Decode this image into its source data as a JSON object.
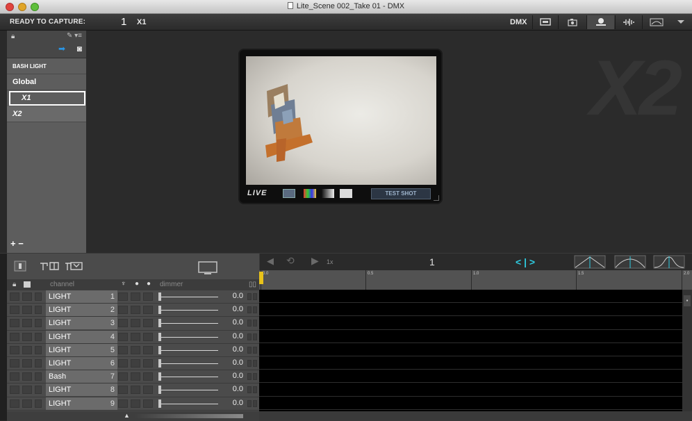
{
  "window": {
    "title": "Lite_Scene 002_Take 01 - DMX"
  },
  "topbar": {
    "status": "READY TO CAPTURE:",
    "frame": "1",
    "scene": "X1",
    "mode": "DMX"
  },
  "sidebar": {
    "header": "BASH LIGHT",
    "items": [
      {
        "label": "Global"
      },
      {
        "label": "X1"
      },
      {
        "label": "X2"
      }
    ],
    "add_remove": "+ −"
  },
  "viewer": {
    "scene_watermark": "X2",
    "live_label": "LIVE",
    "test_shot_label": "TEST SHOT"
  },
  "channels": {
    "header": {
      "channel": "channel",
      "dimmer": "dimmer"
    },
    "rows": [
      {
        "name": "LIGHT",
        "num": "1",
        "value": "0.0"
      },
      {
        "name": "LIGHT",
        "num": "2",
        "value": "0.0"
      },
      {
        "name": "LIGHT",
        "num": "3",
        "value": "0.0"
      },
      {
        "name": "LIGHT",
        "num": "4",
        "value": "0.0"
      },
      {
        "name": "LIGHT",
        "num": "5",
        "value": "0.0"
      },
      {
        "name": "LIGHT",
        "num": "6",
        "value": "0.0"
      },
      {
        "name": "Bash",
        "num": "7",
        "value": "0.0"
      },
      {
        "name": "LIGHT",
        "num": "8",
        "value": "0.0"
      },
      {
        "name": "LIGHT",
        "num": "9",
        "value": "0.0"
      }
    ]
  },
  "timeline": {
    "speed": "1x",
    "frame": "1",
    "nav": "< | >",
    "ticks": [
      "0.0",
      "0.5",
      "1.0",
      "1.5",
      "2.0"
    ]
  },
  "colors": {
    "accent": "#2a96e6",
    "nav": "#2ecbe0",
    "playhead": "#e8c21a"
  }
}
